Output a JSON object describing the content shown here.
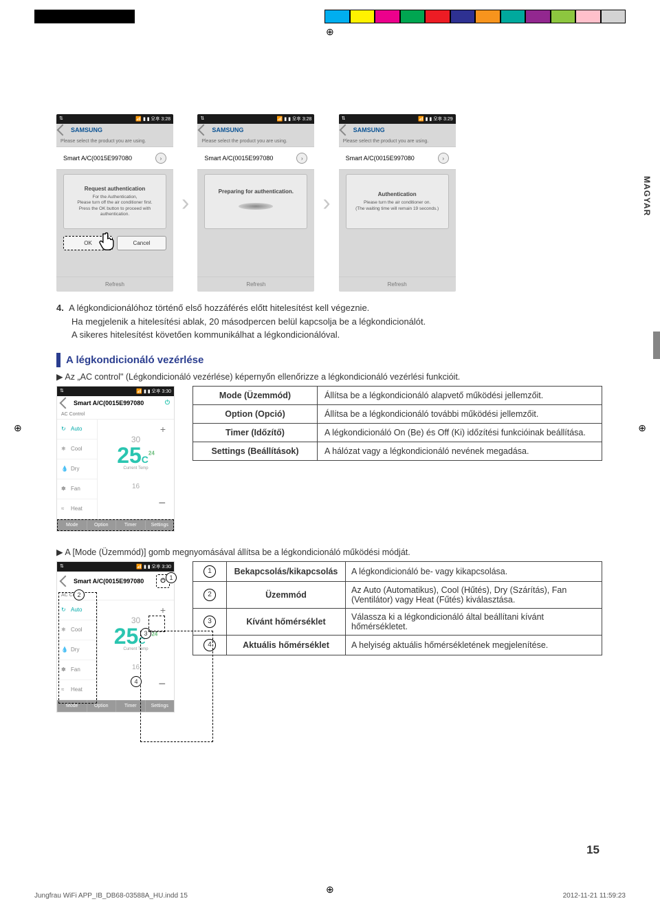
{
  "printbar_colors": [
    "#000",
    "#000",
    "#000",
    "#000",
    "transparent",
    "transparent",
    "transparent",
    "transparent",
    "transparent",
    "transparent",
    "transparent",
    "transparent",
    "#00aeef",
    "#fff200",
    "#ec008c",
    "#00a651",
    "#ed1c24",
    "#2e3192",
    "#f7941d",
    "#00a99d",
    "#92278f",
    "#8dc63f",
    "#ffc0cb",
    "#d3d3d3"
  ],
  "side_label": "MAGYAR",
  "status_left": "⇅",
  "status_right_icons": "📶 ▮ ▮",
  "phones": {
    "brand": "SAMSUNG",
    "subhdr": "Please select the product you are using.",
    "device": "Smart A/C(0015E997080",
    "refresh": "Refresh",
    "p1": {
      "time": "3:28",
      "title": "Request authentication",
      "body": "For the Authentication,\nPlease turn off the air conditioner first.\nPress the OK button to proceed with\nauthentication.",
      "ok": "OK",
      "cancel": "Cancel"
    },
    "p2": {
      "time": "3:28",
      "title": "Preparing for authentication."
    },
    "p3": {
      "time": "3:29",
      "title": "Authentication",
      "body": "Please turn the air conditioner on.\n(The waiting time will remain 19 seconds.)"
    }
  },
  "step4": {
    "num": "4.",
    "l1": "A légkondicionálóhoz történő első hozzáférés előtt hitelesítést kell végeznie.",
    "l2": "Ha megjelenik a hitelesítési ablak, 20 másodpercen belül kapcsolja be a légkondicionálót.",
    "l3": "A sikeres hitelesítést követően kommunikálhat a légkondicionálóval."
  },
  "section1": {
    "title": "A légkondicionáló vezérlése",
    "bullet": "▶  Az „AC control\" (Légkondicionáló vezérlése) képernyőn ellenőrizze a légkondicionáló vezérlési funkcióit."
  },
  "ac": {
    "time": "3:30",
    "title": "Smart A/C(0015E997080",
    "sub": "AC Control",
    "modes": [
      "Auto",
      "Cool",
      "Dry",
      "Fan",
      "Heat"
    ],
    "set": "30",
    "big": "25",
    "c": "C",
    "cur_lbl": "Current Temp",
    "cur": "24",
    "alt": "16",
    "tabs": [
      "Mode",
      "Option",
      "Timer",
      "Settings"
    ]
  },
  "func_table": [
    {
      "k": "Mode (Üzemmód)",
      "v": "Állítsa be a légkondicionáló alapvető működési jellemzőit."
    },
    {
      "k": "Option (Opció)",
      "v": "Állítsa be a légkondicionáló további működési jellemzőit."
    },
    {
      "k": "Timer (Időzítő)",
      "v": "A légkondicionáló On (Be) és Off (Ki) időzítési funkcióinak beállítása."
    },
    {
      "k": "Settings (Beállítások)",
      "v": "A hálózat vagy a légkondicionáló nevének megadása."
    }
  ],
  "section2": {
    "bullet": "▶  A [Mode (Üzemmód)] gomb megnyomásával állítsa be a légkondicionáló működési módját."
  },
  "mode_table": [
    {
      "n": "1",
      "k": "Bekapcsolás/kikapcsolás",
      "v": "A légkondicionáló be- vagy kikapcsolása."
    },
    {
      "n": "2",
      "k": "Üzemmód",
      "v": "Az Auto (Automatikus), Cool (Hűtés), Dry (Szárítás), Fan (Ventilátor) vagy Heat (Fűtés) kiválasztása."
    },
    {
      "n": "3",
      "k": "Kívánt hőmérséklet",
      "v": "Válassza ki a légkondicionáló által beállítani kívánt hőmérsékletet."
    },
    {
      "n": "4",
      "k": "Aktuális hőmérséklet",
      "v": "A helyiség aktuális hőmérsékletének megjelenítése."
    }
  ],
  "page_num": "15",
  "footer": {
    "file": "Jungfrau WiFi APP_IB_DB68-03588A_HU.indd   15",
    "date": "2012-11-21   11:59:23"
  }
}
